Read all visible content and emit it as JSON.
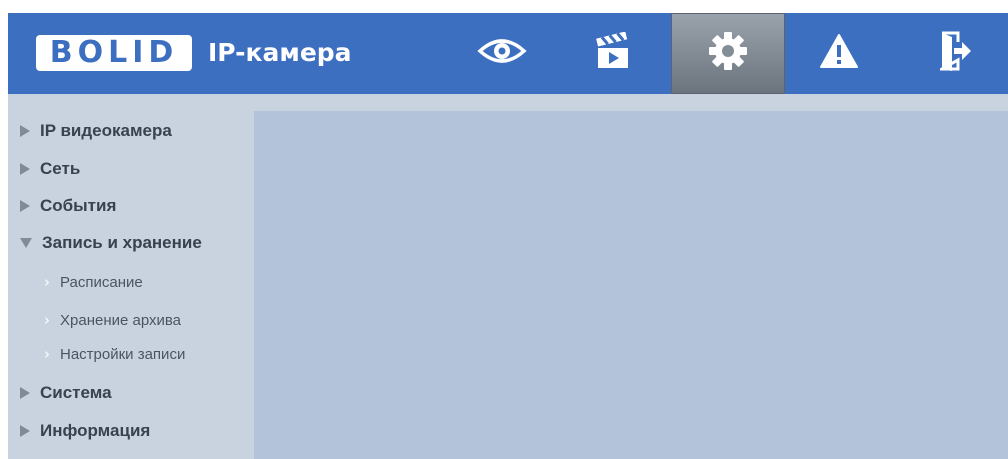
{
  "header": {
    "logo_text": "BOLID",
    "product_title": "IP-камера",
    "nav": [
      {
        "name": "live-view",
        "icon": "eye-icon",
        "active": false
      },
      {
        "name": "playback",
        "icon": "clapperboard-icon",
        "active": false
      },
      {
        "name": "settings",
        "icon": "gear-icon",
        "active": true
      },
      {
        "name": "alarm",
        "icon": "warning-icon",
        "active": false
      },
      {
        "name": "logout",
        "icon": "exit-door-icon",
        "active": false
      }
    ]
  },
  "sidebar": {
    "items": [
      {
        "label": "IP видеокамера",
        "expanded": false
      },
      {
        "label": "Сеть",
        "expanded": false
      },
      {
        "label": "События",
        "expanded": false
      },
      {
        "label": "Запись и хранение",
        "expanded": true
      },
      {
        "label": "Система",
        "expanded": false
      },
      {
        "label": "Информация",
        "expanded": false
      }
    ],
    "subitems": [
      {
        "label": "Расписание"
      },
      {
        "label": "Хранение архива"
      },
      {
        "label": "Настройки записи"
      }
    ]
  },
  "colors": {
    "header": "#3d6fc0",
    "sidebar": "#c9d3e0",
    "content": "#b3c3d9",
    "active_tab": "#7e8891"
  }
}
